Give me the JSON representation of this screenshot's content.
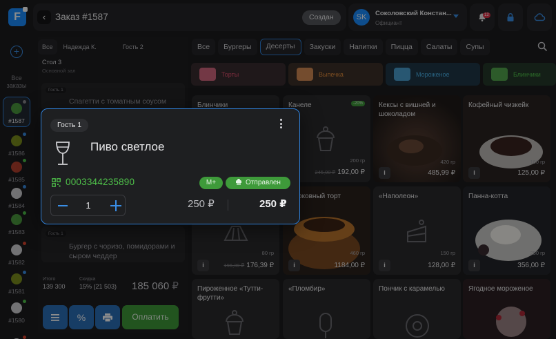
{
  "app": {
    "logo_letter": "F"
  },
  "header": {
    "order_title": "Заказ #1587",
    "status": "Создан",
    "user": {
      "initials": "SK",
      "name": "Соколовский Констан...",
      "role": "Официант"
    },
    "notifications_count": "12"
  },
  "rail": {
    "all_orders_label": "Все заказы",
    "orders": [
      {
        "number": "#1587",
        "active": true,
        "color": "#4c9a3e",
        "dot": "#8a8a8f"
      },
      {
        "number": "#1586",
        "active": false,
        "color": "#7d8f1e",
        "dot": "#3a8ee6"
      },
      {
        "number": "#1585",
        "active": false,
        "color": "#b3402f",
        "dot": "#4fc24a"
      },
      {
        "number": "#1584",
        "active": false,
        "color": "#cfcfd3",
        "dot": "#3a8ee6"
      },
      {
        "number": "#1583",
        "active": false,
        "color": "#4c9a3e",
        "dot": "#4fc24a"
      },
      {
        "number": "#1582",
        "active": false,
        "color": "#cfcfd3",
        "dot": "#d9442e"
      },
      {
        "number": "#1581",
        "active": false,
        "color": "#7d8f1e",
        "dot": "#3a8ee6"
      },
      {
        "number": "#1580",
        "active": false,
        "color": "#cfcfd3",
        "dot": "#4fc24a"
      },
      {
        "number": "",
        "active": false,
        "color": "#cfcfd3",
        "dot": "#d9442e"
      }
    ]
  },
  "order_panel": {
    "guest_tabs": [
      "Все",
      "Надежда К.",
      "Гость 2"
    ],
    "table_name": "Стол 3",
    "hall": "Основной зал",
    "items": [
      {
        "guest_tag": "Гость 1",
        "text": "Спагетти с томатным соусом"
      },
      {
        "guest_tag": "Гость 1",
        "text": "Бургер с чоризо, помидорами и сыром чеддер"
      }
    ],
    "summary": {
      "subtotal_label": "Итого",
      "subtotal_value": "139 300",
      "discount_label": "Скидка",
      "discount_value": "15% (21 503)",
      "total": "185 060",
      "currency": "₽"
    },
    "pay_label": "Оплатить"
  },
  "categories": {
    "tabs": [
      "Все",
      "Бургеры",
      "Десерты",
      "Закуски",
      "Напитки",
      "Пицца",
      "Салаты",
      "Супы"
    ],
    "active": "Десерты",
    "subcategories": [
      {
        "label": "Торты",
        "bg": "#3a2c30",
        "color": "#e0506e"
      },
      {
        "label": "Выпечка",
        "bg": "#3c3128",
        "color": "#e08a3c"
      },
      {
        "label": "Мороженое",
        "bg": "#1f3747",
        "color": "#4ab1e8"
      },
      {
        "label": "Блинчики",
        "bg": "#263a2a",
        "color": "#4fc24a"
      }
    ]
  },
  "products": [
    {
      "name": "Блинчики",
      "weight": "",
      "price": "",
      "old_price": ""
    },
    {
      "name": "Канеле",
      "weight": "200 гр",
      "price": "192,00 ₽",
      "old_price": "245,00 ₽",
      "badge": "-20%"
    },
    {
      "name": "Кексы с вишней и шоколадом",
      "weight": "420 гр",
      "price": "485,99 ₽",
      "old_price": ""
    },
    {
      "name": "Кофейный чизкейк",
      "weight": "180 гр",
      "price": "125,00 ₽",
      "old_price": ""
    },
    {
      "name": "",
      "weight": "80 гр",
      "price": "176,39 ₽",
      "old_price": "196,39 ₽"
    },
    {
      "name": "Морковный торт",
      "weight": "460 гр",
      "price": "1184,00 ₽",
      "old_price": ""
    },
    {
      "name": "«Наполеон»",
      "weight": "150 гр",
      "price": "128,00 ₽",
      "old_price": ""
    },
    {
      "name": "Панна-котта",
      "weight": "250 гр",
      "price": "356,00 ₽",
      "old_price": ""
    },
    {
      "name": "Пироженное «Тутти-фрутти»",
      "weight": "",
      "price": "",
      "old_price": ""
    },
    {
      "name": "«Пломбир»",
      "weight": "",
      "price": "",
      "old_price": ""
    },
    {
      "name": "Пончик с карамелью",
      "weight": "",
      "price": "",
      "old_price": ""
    },
    {
      "name": "Ягодное мороженое",
      "weight": "",
      "price": "",
      "old_price": ""
    }
  ],
  "modal": {
    "guest": "Гость 1",
    "product_name": "Пиво светлое",
    "icon": "wine-glass-icon",
    "code": "0003344235890",
    "size_pill": "M+",
    "status_pill": "Отправлен",
    "quantity": "1",
    "unit_price": "250 ₽",
    "total_price": "250 ₽"
  },
  "colors": {
    "accent": "#2f7fd6",
    "green": "#3e9a3a",
    "code_green": "#4fc24a"
  }
}
